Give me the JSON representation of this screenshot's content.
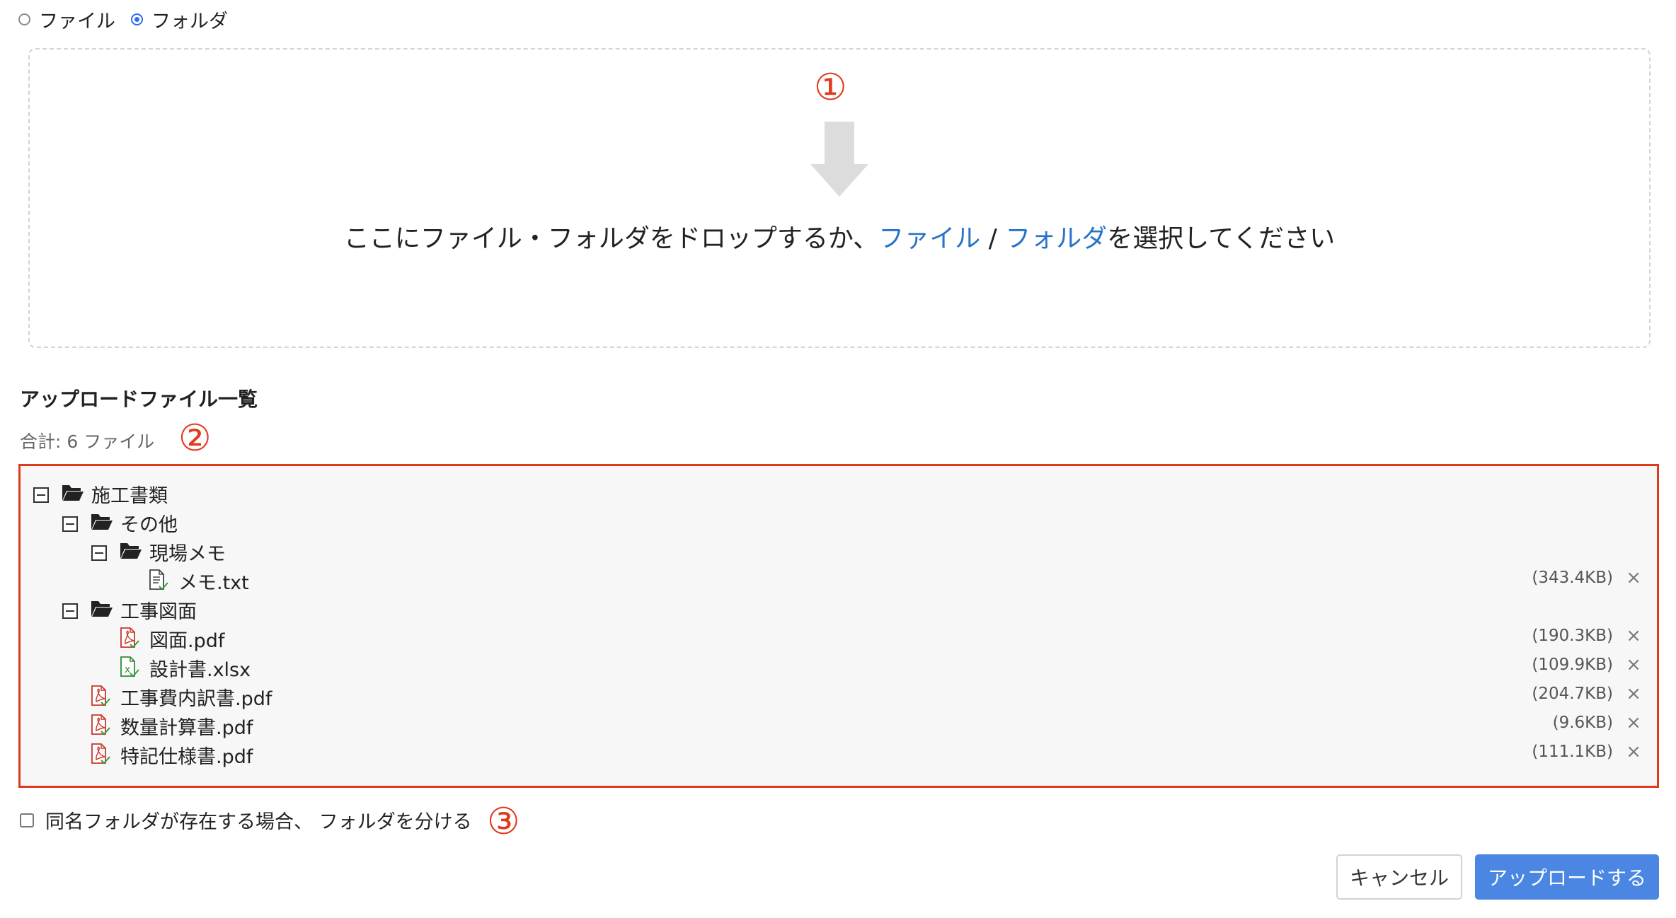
{
  "upload_type": {
    "options": [
      {
        "label": "ファイル",
        "checked": false
      },
      {
        "label": "フォルダ",
        "checked": true
      }
    ]
  },
  "dropzone": {
    "marker": "①",
    "text_before": "ここにファイル・フォルダをドロップするか、",
    "file_link": "ファイル",
    "separator": " / ",
    "folder_link": "フォルダ",
    "text_after": "を選択してください"
  },
  "file_list": {
    "title": "アップロードファイル一覧",
    "total": "合計: 6 ファイル",
    "marker": "②",
    "rows": [
      {
        "type": "folder",
        "name": "施工書類",
        "level": 0,
        "expanded": true
      },
      {
        "type": "folder",
        "name": "その他",
        "level": 1,
        "expanded": true
      },
      {
        "type": "folder",
        "name": "現場メモ",
        "level": 2,
        "expanded": true
      },
      {
        "type": "file",
        "kind": "text",
        "name": "メモ.txt",
        "level": 3,
        "size": "(343.4KB)"
      },
      {
        "type": "folder",
        "name": "工事図面",
        "level": 1,
        "expanded": true
      },
      {
        "type": "file",
        "kind": "pdf",
        "name": "図面.pdf",
        "level": 2,
        "size": "(190.3KB)"
      },
      {
        "type": "file",
        "kind": "excel",
        "name": "設計書.xlsx",
        "level": 2,
        "size": "(109.9KB)"
      },
      {
        "type": "file",
        "kind": "pdf",
        "name": "工事費内訳書.pdf",
        "level": 1,
        "size": "(204.7KB)"
      },
      {
        "type": "file",
        "kind": "pdf",
        "name": "数量計算書.pdf",
        "level": 1,
        "size": "(9.6KB)"
      },
      {
        "type": "file",
        "kind": "pdf",
        "name": "特記仕様書.pdf",
        "level": 1,
        "size": "(111.1KB)"
      }
    ],
    "remove_glyph": "×"
  },
  "options": {
    "separate_folder_label": "同名フォルダが存在する場合、 フォルダを分ける",
    "separate_folder_checked": false,
    "marker": "③"
  },
  "buttons": {
    "cancel": "キャンセル",
    "upload": "アップロードする"
  },
  "colors": {
    "accent": "#2d6ff0",
    "link": "#2b73c8",
    "marker": "#e03a1e",
    "primary_button": "#4a86e2",
    "pdf_icon": "#c8372c",
    "excel_icon": "#2e8b3a",
    "check": "#3a9b3a"
  }
}
